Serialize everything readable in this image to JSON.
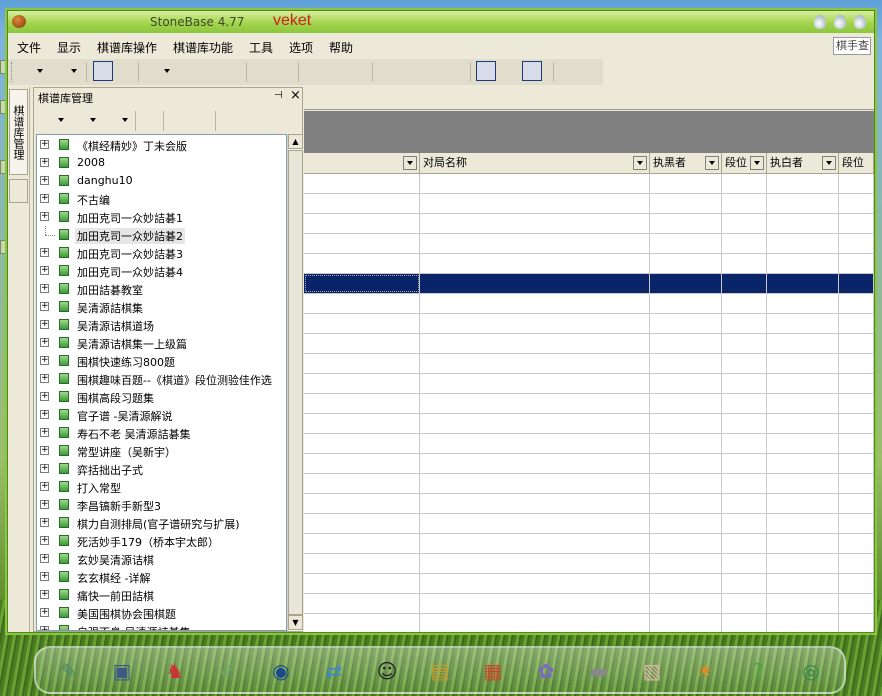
{
  "window": {
    "title": "StoneBase 4.77",
    "brand": "veket"
  },
  "menu": {
    "items": [
      "文件",
      "显示",
      "棋谱库操作",
      "棋谱库功能",
      "工具",
      "选项",
      "帮助"
    ],
    "search_placeholder": "棋手查"
  },
  "side_tab": {
    "label": "棋谱库管理"
  },
  "panel": {
    "title": "棋谱库管理",
    "pin_glyph": "⊣",
    "close_glyph": "×"
  },
  "tree": {
    "items": [
      "《棋经精妙》丁未会版",
      "2008",
      "danghu10",
      "不古编",
      "加田克司一众妙詰碁1",
      "加田克司一众妙詰碁2",
      "加田克司一众妙詰碁3",
      "加田克司一众妙詰碁4",
      "加田詰碁教室",
      "吴清源詰棋集",
      "吴清源诘棋道场",
      "吴清源诘棋集一上级篇",
      "围棋快速练习800题",
      "围棋趣味百题--《棋道》段位测验佳作选",
      "围棋高段习题集",
      "官子谱 -吴清源解说",
      "寿石不老  吴清源詰碁集",
      "常型讲座（吴新宇）",
      "弈括拙出子式",
      "打入常型",
      "李昌镐新手新型3",
      "棋力自测排局(官子谱研究与扩展)",
      "死活妙手179（桥本宇太郎）",
      "玄妙吴清源诘棋",
      "玄玄棋经  -详解",
      "痛快一前田詰棋",
      "美国围棋协会围棋题",
      "自强不息  吴清源詰碁集"
    ],
    "selected_index": 5
  },
  "grid": {
    "columns": [
      "",
      "对局名称",
      "执黑者",
      "段位",
      "执白者",
      "段位"
    ],
    "row_count": 23,
    "selected_row": 5
  },
  "colors": {
    "selection": "#0a246a",
    "titlebar": "#a4d44e",
    "brand": "#d02020"
  },
  "dock": {
    "icons": [
      "drawing-icon",
      "monitor-icon",
      "pet-icon",
      "notes-icon",
      "media-player-icon",
      "network-icon",
      "penguin-icon",
      "notebook-icon",
      "chart-icon",
      "paint-icon",
      "usb-drive-icon",
      "image-icon",
      "lion-icon",
      "help-icon",
      "camera-icon"
    ]
  }
}
